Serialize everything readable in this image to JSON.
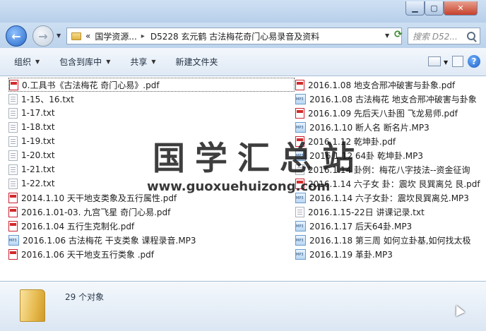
{
  "navigation": {
    "breadcrumbs": [
      "«",
      "国学资源...",
      "▸",
      "D5228 玄元鹤 古法梅花奇门心易录音及资料"
    ],
    "search_placeholder": "搜索 D52..."
  },
  "toolbar": {
    "organize": "组织",
    "include_library": "包含到库中",
    "share": "共享",
    "new_folder": "新建文件夹"
  },
  "files_left": [
    {
      "name": "0.工具书《古法梅花 奇门心易》.pdf",
      "type": "pdf",
      "selected": true
    },
    {
      "name": "1-15、16.txt",
      "type": "txt"
    },
    {
      "name": "1-17.txt",
      "type": "txt"
    },
    {
      "name": "1-18.txt",
      "type": "txt"
    },
    {
      "name": "1-19.txt",
      "type": "txt"
    },
    {
      "name": "1-20.txt",
      "type": "txt"
    },
    {
      "name": "1-21.txt",
      "type": "txt"
    },
    {
      "name": "1-22.txt",
      "type": "txt"
    },
    {
      "name": "2014.1.10 天干地支类象及五行属性.pdf",
      "type": "pdf"
    },
    {
      "name": "2016.1.01-03. 九宫飞星 奇门心易.pdf",
      "type": "pdf"
    },
    {
      "name": "2016.1.04 五行生克制化.pdf",
      "type": "pdf"
    },
    {
      "name": "2016.1.06 古法梅花 干支类象 课程录音.MP3",
      "type": "mp3"
    },
    {
      "name": "2016.1.06 天干地支五行类象 .pdf",
      "type": "pdf"
    }
  ],
  "files_right": [
    {
      "name": "2016.1.08 地支合邢冲破害与卦象.pdf",
      "type": "pdf"
    },
    {
      "name": "2016.1.08 古法梅花 地支合邢冲破害与卦象",
      "type": "mp3"
    },
    {
      "name": "2016.1.09 先后天八卦图 飞龙易师.pdf",
      "type": "pdf"
    },
    {
      "name": "2016.1.10 断人名 断名片.MP3",
      "type": "mp3"
    },
    {
      "name": "2016.1.12  乾坤卦.pdf",
      "type": "pdf"
    },
    {
      "name": "2016.1.12 64卦 乾坤卦.MP3",
      "type": "mp3"
    },
    {
      "name": "2016.1.14  卦例：梅花八字技法--资金征询",
      "type": "txt"
    },
    {
      "name": "2016.1.14 六子女 卦：震坎 艮巽离兑 艮.pdf",
      "type": "pdf"
    },
    {
      "name": "2016.1.14 六子女卦：震坎艮巽离兑.MP3",
      "type": "mp3"
    },
    {
      "name": "2016.1.15-22日 讲课记录.txt",
      "type": "txt"
    },
    {
      "name": "2016.1.17 后天64卦.MP3",
      "type": "mp3"
    },
    {
      "name": "2016.1.18 第三周 如何立卦基,如何找太极",
      "type": "mp3"
    },
    {
      "name": "2016.1.19  革卦.MP3",
      "type": "mp3"
    }
  ],
  "watermark": {
    "title": "国学汇总站",
    "url": "www.guoxuehuizong.com"
  },
  "status": {
    "count_text": "29 个对象"
  },
  "icons": {
    "back": "back-arrow-icon",
    "forward": "forward-arrow-icon",
    "help": "help-icon"
  }
}
